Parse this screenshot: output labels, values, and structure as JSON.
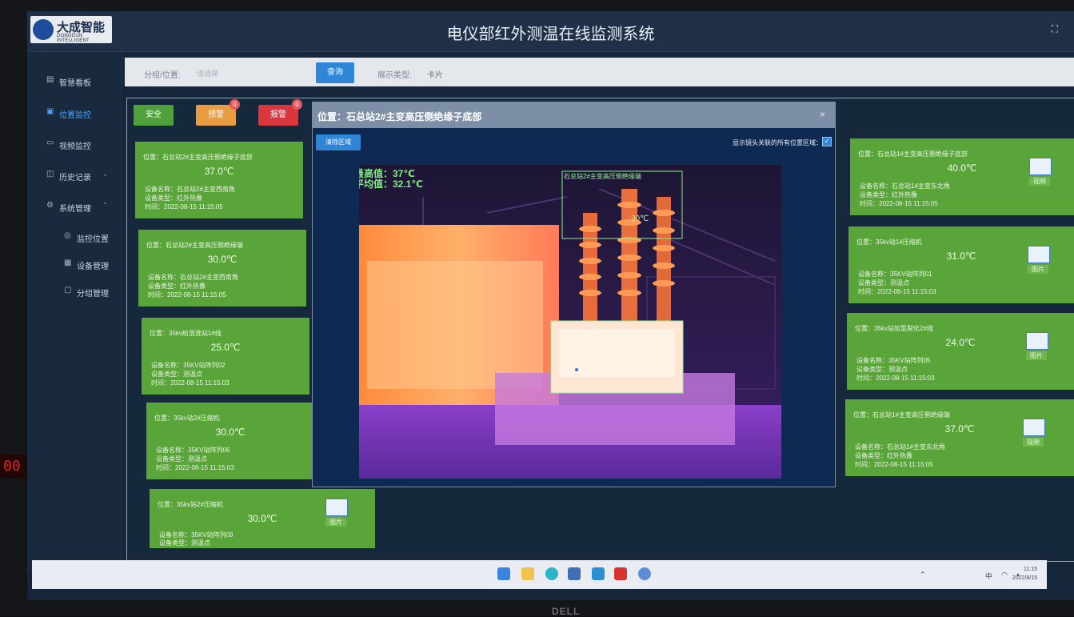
{
  "app": {
    "title": "电仪部红外测温在线监测系统",
    "logo_name": "大成智能",
    "logo_sub": "DONGDUN INTELLIGENT",
    "fullscreen_icon": "expand-icon"
  },
  "sidebar": {
    "items": [
      {
        "label": "智慧看板",
        "icon": "dashboard-icon"
      },
      {
        "label": "位置监控",
        "icon": "monitor-icon",
        "active": true
      },
      {
        "label": "视频监控",
        "icon": "video-icon"
      },
      {
        "label": "历史记录",
        "icon": "history-icon"
      },
      {
        "label": "系统管理",
        "icon": "settings-icon"
      }
    ],
    "sub_items": [
      {
        "label": "监控位置",
        "icon": "location-icon"
      },
      {
        "label": "设备管理",
        "icon": "device-icon"
      },
      {
        "label": "分组管理",
        "icon": "folder-icon"
      }
    ]
  },
  "filter": {
    "group_label": "分组/位置:",
    "group_placeholder": "请选择",
    "query_button": "查询",
    "display_type_label": "展示类型:",
    "display_type_value": "卡片"
  },
  "status_buttons": [
    {
      "label": "安全",
      "color": "#4fa23b"
    },
    {
      "label": "预警",
      "color": "#e89b3f",
      "badge": "0"
    },
    {
      "label": "报警",
      "color": "#d9363e",
      "badge": "0"
    }
  ],
  "cards_left": [
    {
      "position": "位置：石总站2#主变高压侧绝缘子底部",
      "temp": "37.0℃",
      "device": "设备名称：石总站2#主变西南角",
      "type": "设备类型：红外热像",
      "time": "时间：2022-08-15 11:15:05"
    },
    {
      "position": "位置：石总站2#主变高压侧绝缘端",
      "temp": "30.0℃",
      "device": "设备名称：石总站2#主变西南角",
      "type": "设备类型：红外热像",
      "time": "时间：2022-08-15 11:15:05"
    },
    {
      "position": "位置：35kv给混洗站1#线",
      "temp": "25.0℃",
      "device": "设备名称：35KV站阵列02",
      "type": "设备类型：测温点",
      "time": "时间：2022-08-15 11:15:03"
    },
    {
      "position": "位置：35kv站2#压缩机",
      "temp": "30.0℃",
      "device": "设备名称：35KV站阵列06",
      "type": "设备类型：测温点",
      "time": "时间：2022-08-15 11:15:03"
    },
    {
      "position": "位置：35kv站2#压缩机",
      "temp": "30.0℃",
      "device": "设备名称：35KV站阵列09",
      "type": "设备类型：测温点",
      "time": "",
      "cam": "图片"
    }
  ],
  "cards_right": [
    {
      "position": "位置：石总站1#主变高压侧绝缘子底部",
      "temp": "40.0℃",
      "device": "设备名称：石总站1#主变东北角",
      "type": "设备类型：红外热像",
      "time": "时间：2022-08-15 11:15:05",
      "cam": "视频"
    },
    {
      "position": "位置：35kv站1#压缩机",
      "temp": "31.0℃",
      "device": "设备名称：35KV站阵列01",
      "type": "设备类型：测温点",
      "time": "时间：2022-08-15 11:15:03",
      "cam": "图片"
    },
    {
      "position": "位置：35kv站加氢裂化2#线",
      "temp": "24.0℃",
      "device": "设备名称：35KV站阵列05",
      "type": "设备类型：测温点",
      "time": "时间：2022-08-15 11:15:03",
      "cam": "图片"
    },
    {
      "position": "位置：石总站1#主变高压侧绝缘端",
      "temp": "37.0℃",
      "device": "设备名称：石总站1#主变东北角",
      "type": "设备类型：红外热像",
      "time": "时间：2022-08-15 11:15:05",
      "cam": "视频"
    }
  ],
  "modal": {
    "title": "位置：石总站2#主变高压侧绝缘子底部",
    "clear_button": "清除区域",
    "show_all_label": "显示镜头关联的所有位置区域：",
    "max_label": "最高值：37℃",
    "avg_label": "平均值：32.1℃",
    "roi_label": "石总站2#主变高压侧绝缘端",
    "roi_temp": "30℃"
  },
  "taskbar": {
    "tray_lang": "中",
    "time": "11:15",
    "date": "2022/8/15"
  },
  "hardware": {
    "led_text": "00",
    "bezel_brand": "DELL"
  }
}
